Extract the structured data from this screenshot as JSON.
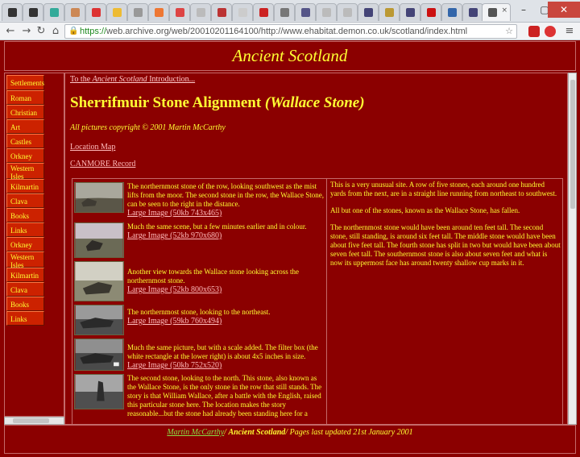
{
  "browser": {
    "url_https": "https://",
    "url_rest": "web.archive.org/web/20010201164100/http://www.ehabitat.demon.co.uk/scotland/index.html",
    "tab_close": "×",
    "window_minimize": "–",
    "window_maximize": "▢",
    "window_close": "✕",
    "back": "←",
    "forward": "→",
    "reload": "↻",
    "home": "⌂",
    "bookmark": "☆",
    "lock": "🔒",
    "menu": "≡"
  },
  "header": {
    "site_title": "Ancient Scotland"
  },
  "sidebar": {
    "items": [
      {
        "label": "Settlements"
      },
      {
        "label": "Roman"
      },
      {
        "label": "Christian"
      },
      {
        "label": "Art"
      },
      {
        "label": "Castles"
      },
      {
        "label": "Orkney"
      },
      {
        "label": "Western Isles"
      },
      {
        "label": "Kilmartin"
      },
      {
        "label": "Clava"
      },
      {
        "label": "Books"
      },
      {
        "label": "Links"
      },
      {
        "label": "Orkney"
      },
      {
        "label": "Western Isles"
      },
      {
        "label": "Kilmartin"
      },
      {
        "label": "Clava"
      },
      {
        "label": "Books"
      },
      {
        "label": "Links"
      }
    ]
  },
  "main": {
    "intro_prefix": "To the ",
    "intro_italic": "Ancient Scotland",
    "intro_suffix": " Introduction...",
    "title_main": "Sherrifmuir Stone Alignment ",
    "title_italic": "(Wallace Stone)",
    "copyright": "All pictures copyright © 2001 Martin McCarthy",
    "location_map": "Location Map",
    "canmore": "CANMORE Record",
    "photos": [
      {
        "text": "The northernmost stone of the row, looking southwest as the mist lifts from the moor. The second stone in the row, the Wallace Stone, can be seen to the right in the distance.",
        "link": "Large Image (50kb 743x465)"
      },
      {
        "text": "Much the same scene, but a few minutes earlier and in colour.",
        "link": "Large Image (52kb 970x680)"
      },
      {
        "text": "Another view towards the Wallace stone looking across the northernmost stone.",
        "link": "Large Image (52kb 800x653)"
      },
      {
        "text": "The northernmost stone, looking to the northeast.",
        "link": "Large Image (59kb 760x494)"
      },
      {
        "text": "Much the same picture, but with a scale added. The filter box (the white rectangle at the lower right) is about 4x5 inches in size.",
        "link": "Large Image (50kb 752x520)"
      },
      {
        "text": "The second stone, looking to the north. This stone, also known as the Wallace Stone, is the only stone in the row that still stands. The story is that William Wallace, after a battle with the English, raised this particular stone here. The location makes the story reasonable...but the stone had already been standing here for a",
        "link": ""
      }
    ],
    "right_paragraphs": [
      "This is a very unusual site. A row of five stones, each around one hundred yards from the next, are in a straight line running from northeast to southwest.",
      "All but one of the stones, known as the Wallace Stone, has fallen.",
      "The northernmost stone would have been around ten feet tall. The second stone, still standing, is around six feet tall. The middle stone would have been about five feet tall. The fourth stone has split in two but would have been about seven feet tall. The southernmost stone is also about seven feet and what is now its uppermost face has around twenty shallow cup marks in it."
    ]
  },
  "footer": {
    "author": "Martin McCarthy",
    "sep1": "/ ",
    "site": "Ancient Scotland",
    "rest": "/ Pages last updated 21st January 2001"
  },
  "colors": {
    "background": "#8b0000",
    "title_yellow": "#ffff33",
    "nav_button": "#cc2200",
    "link": "#ffbbbb"
  }
}
